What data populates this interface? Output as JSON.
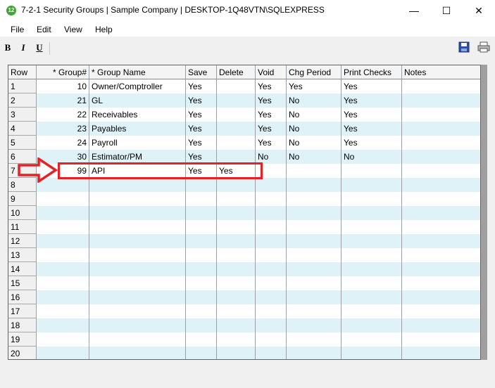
{
  "window": {
    "title": "7-2-1 Security Groups  |  Sample Company  |  DESKTOP-1Q48VTN\\SQLEXPRESS",
    "app_icon_text": "12",
    "minimize": "—",
    "maximize": "☐",
    "close": "✕"
  },
  "menu": [
    "File",
    "Edit",
    "View",
    "Help"
  ],
  "toolbar": {
    "bold": "B",
    "italic": "I",
    "underline": "U",
    "save_icon": "save-icon",
    "print_icon": "print-icon"
  },
  "table": {
    "columns": [
      "Row",
      "* Group#",
      "* Group Name",
      "Save",
      "Delete",
      "Void",
      "Chg Period",
      "Print Checks",
      "Notes"
    ],
    "rows": [
      [
        "1",
        "10",
        "Owner/Comptroller",
        "Yes",
        "",
        "Yes",
        "Yes",
        "Yes",
        ""
      ],
      [
        "2",
        "21",
        "GL",
        "Yes",
        "",
        "Yes",
        "No",
        "Yes",
        ""
      ],
      [
        "3",
        "22",
        "Receivables",
        "Yes",
        "",
        "Yes",
        "No",
        "Yes",
        ""
      ],
      [
        "4",
        "23",
        "Payables",
        "Yes",
        "",
        "Yes",
        "No",
        "Yes",
        ""
      ],
      [
        "5",
        "24",
        "Payroll",
        "Yes",
        "",
        "Yes",
        "No",
        "Yes",
        ""
      ],
      [
        "6",
        "30",
        "Estimator/PM",
        "Yes",
        "",
        "No",
        "No",
        "No",
        ""
      ],
      [
        "7",
        "99",
        "API",
        "Yes",
        "Yes",
        "",
        "",
        "",
        ""
      ],
      [
        "8",
        "",
        "",
        "",
        "",
        "",
        "",
        "",
        ""
      ],
      [
        "9",
        "",
        "",
        "",
        "",
        "",
        "",
        "",
        ""
      ],
      [
        "10",
        "",
        "",
        "",
        "",
        "",
        "",
        "",
        ""
      ],
      [
        "11",
        "",
        "",
        "",
        "",
        "",
        "",
        "",
        ""
      ],
      [
        "12",
        "",
        "",
        "",
        "",
        "",
        "",
        "",
        ""
      ],
      [
        "13",
        "",
        "",
        "",
        "",
        "",
        "",
        "",
        ""
      ],
      [
        "14",
        "",
        "",
        "",
        "",
        "",
        "",
        "",
        ""
      ],
      [
        "15",
        "",
        "",
        "",
        "",
        "",
        "",
        "",
        ""
      ],
      [
        "16",
        "",
        "",
        "",
        "",
        "",
        "",
        "",
        ""
      ],
      [
        "17",
        "",
        "",
        "",
        "",
        "",
        "",
        "",
        ""
      ],
      [
        "18",
        "",
        "",
        "",
        "",
        "",
        "",
        "",
        ""
      ],
      [
        "19",
        "",
        "",
        "",
        "",
        "",
        "",
        "",
        ""
      ],
      [
        "20",
        "",
        "",
        "",
        "",
        "",
        "",
        "",
        ""
      ]
    ]
  },
  "colors": {
    "alt_row": "#dff2f8",
    "highlight": "#e62025",
    "app_icon": "#3fa535"
  }
}
